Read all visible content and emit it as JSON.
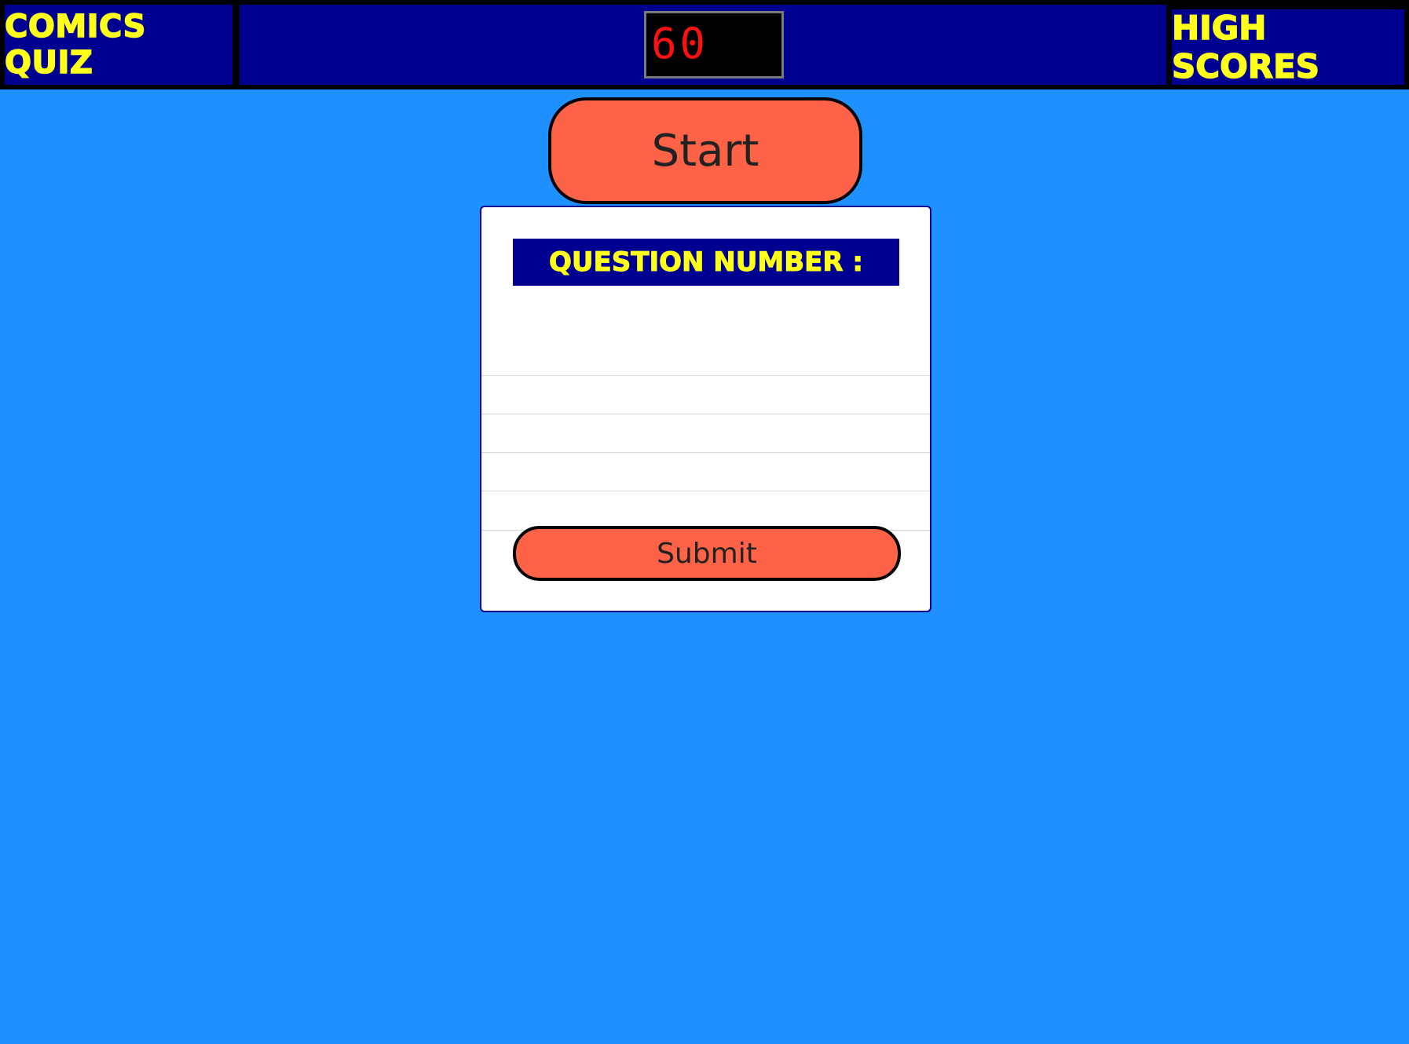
{
  "header": {
    "brand": "Comics Quiz",
    "timer": "60",
    "high_scores_label": "High Scores"
  },
  "start_button": {
    "label": "Start"
  },
  "quiz": {
    "question_number_label": "Question Number :",
    "question_text": "",
    "choices": [
      "",
      "",
      "",
      ""
    ],
    "submit_label": "Submit"
  },
  "colors": {
    "background": "#1e90ff",
    "navy": "#000090",
    "accent_yellow": "#ffff1a",
    "button": "#ff6347",
    "timer_text": "#ff1010"
  }
}
